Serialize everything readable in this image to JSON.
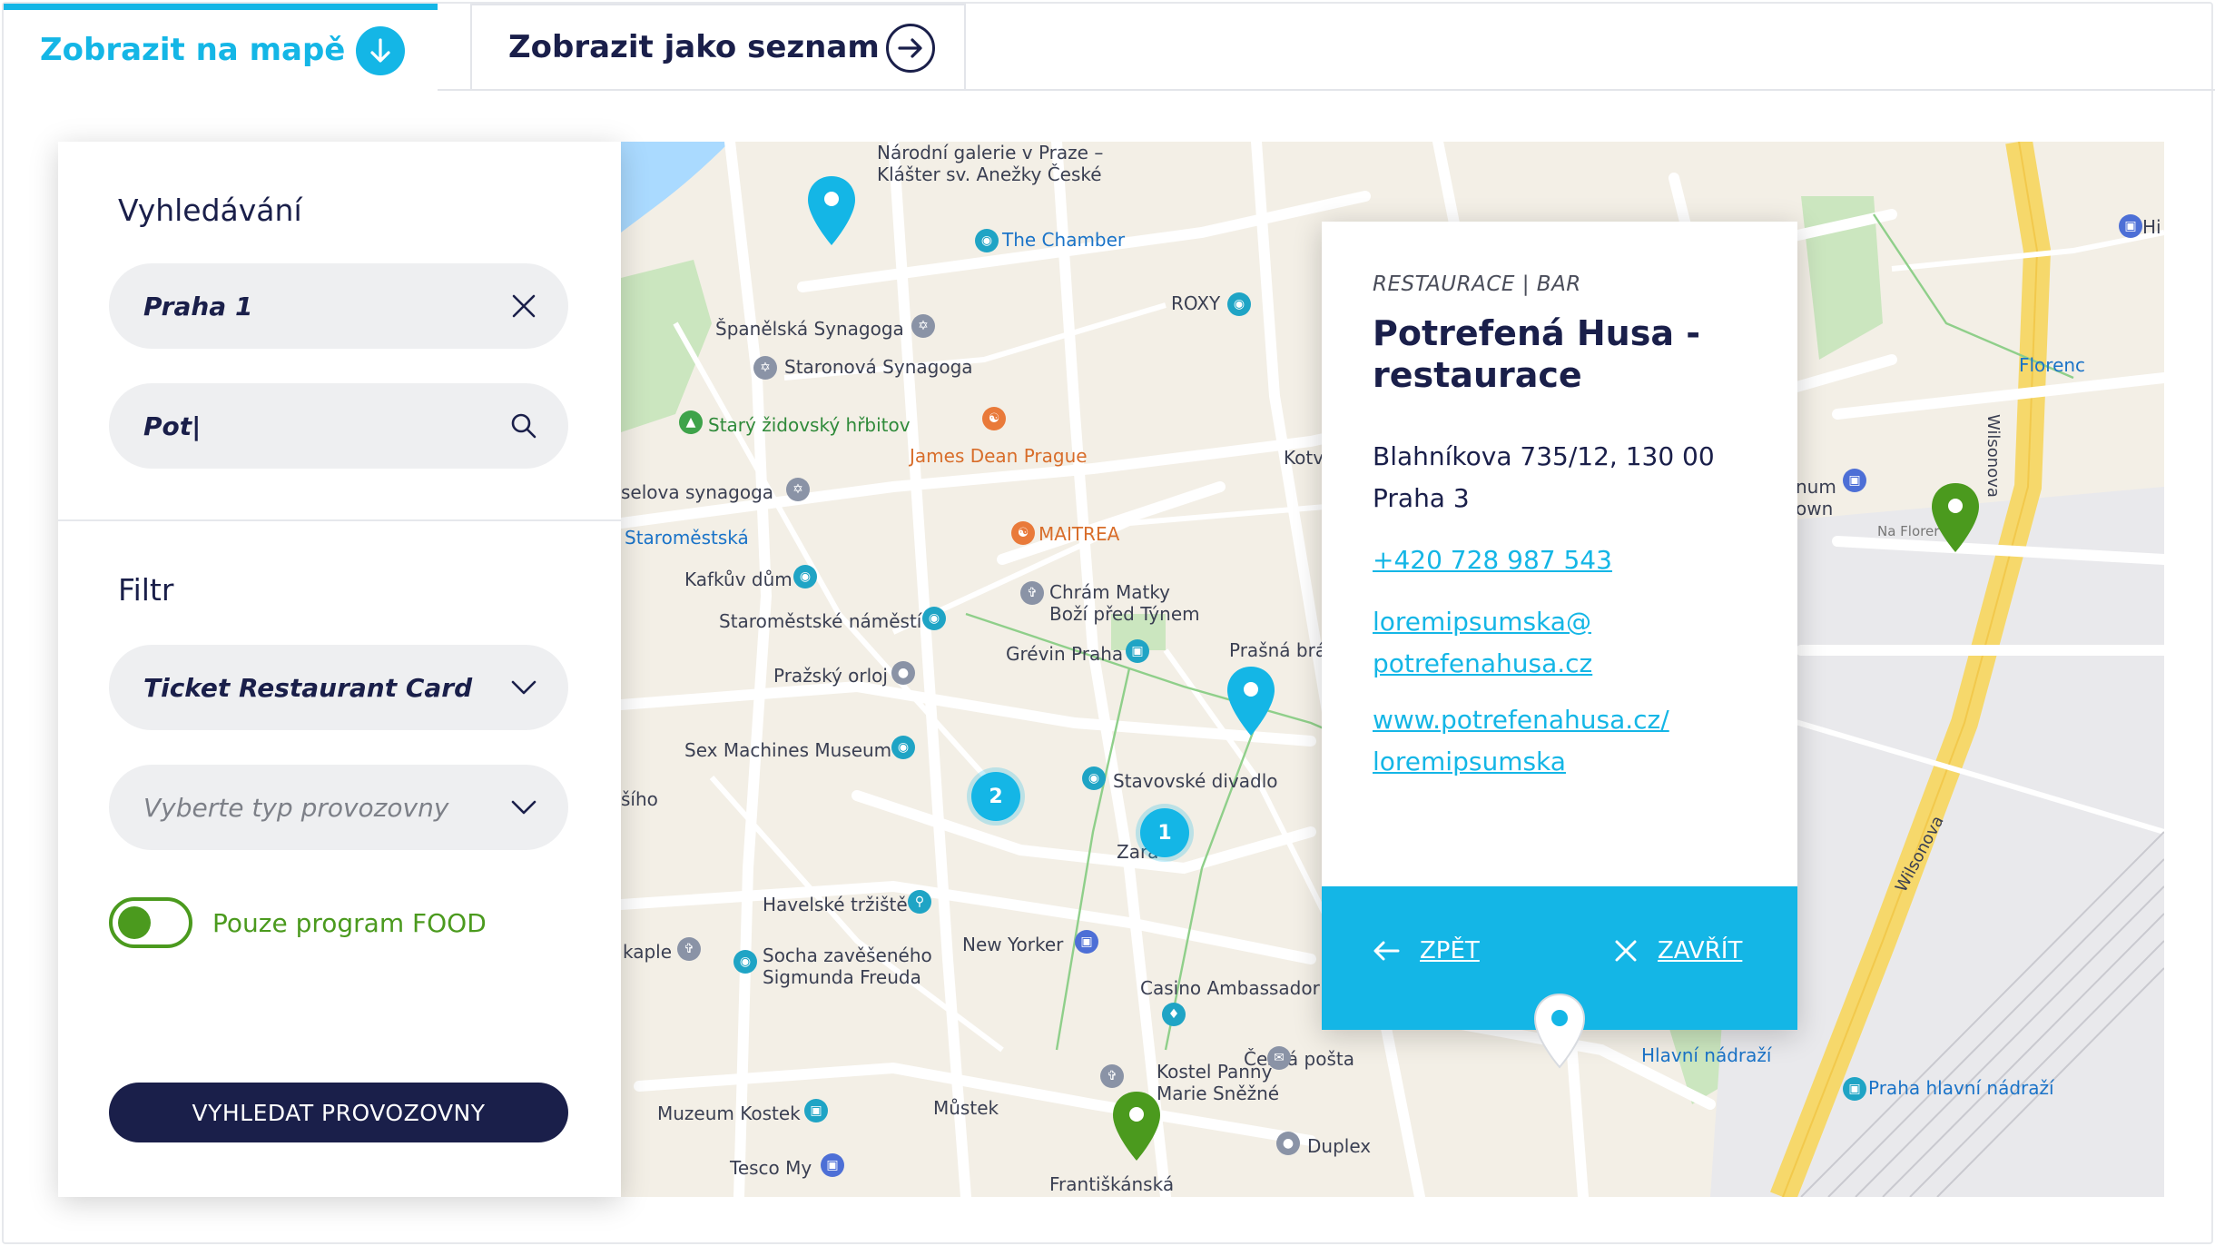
{
  "tabs": [
    {
      "label": "Zobrazit na mapě",
      "icon": "arrow-down-icon",
      "active": true
    },
    {
      "label": "Zobrazit jako seznam",
      "icon": "arrow-right-icon",
      "active": false
    }
  ],
  "sidebar": {
    "search_heading": "Vyhledávání",
    "location_value": "Praha 1",
    "query_value": "Pot|",
    "filter_heading": "Filtr",
    "card_select_value": "Ticket Restaurant Card",
    "type_select_placeholder": "Vyberte typ provozovny",
    "food_toggle_label": "Pouze program FOOD",
    "food_toggle_on": true,
    "search_button": "VYHLEDAT PROVOZOVNY"
  },
  "map_labels": [
    {
      "text": "Národní galerie v Praze –\nKlášter sv. Anežky České"
    },
    {
      "text": "The Chamber"
    },
    {
      "text": "Španělská Synagoga"
    },
    {
      "text": "Staronová Synagoga"
    },
    {
      "text": "Starý židovský hřbitov"
    },
    {
      "text": "James Dean Prague"
    },
    {
      "text": "selova synagoga"
    },
    {
      "text": "Staroměstská"
    },
    {
      "text": "MAITREA"
    },
    {
      "text": "Kafkův dům"
    },
    {
      "text": "Chrám Matky\nBoží před Týnem"
    },
    {
      "text": "Staroměstské náměstí"
    },
    {
      "text": "Grévin Praha"
    },
    {
      "text": "Pražský orloj"
    },
    {
      "text": "Prašná brá"
    },
    {
      "text": "Sex Machines Museum"
    },
    {
      "text": "Stavovské divadlo"
    },
    {
      "text": "Zara"
    },
    {
      "text": "Havelské tržiště"
    },
    {
      "text": "New Yorker"
    },
    {
      "text": "kaple"
    },
    {
      "text": "Socha zavěšeného\nSigmunda Freuda"
    },
    {
      "text": "Casino Ambassador"
    },
    {
      "text": "Kostel Panny\nMarie Sněžné"
    },
    {
      "text": "Česká pošta"
    },
    {
      "text": "Muzeum Kostek"
    },
    {
      "text": "Můstek"
    },
    {
      "text": "Duplex"
    },
    {
      "text": "Tesco My"
    },
    {
      "text": "Františkánská"
    },
    {
      "text": "ROXY"
    },
    {
      "text": "Florenc"
    },
    {
      "text": "Hlavní nádraží"
    },
    {
      "text": "Praha hlavní nádraží"
    },
    {
      "text": "Wilsonova"
    },
    {
      "text": "Wilsonova"
    },
    {
      "text": "Kotv"
    },
    {
      "text": "šího"
    },
    {
      "text": "num\nown"
    },
    {
      "text": "Na Florer"
    },
    {
      "text": "Hi"
    }
  ],
  "clusters": [
    {
      "count": "2"
    },
    {
      "count": "1"
    }
  ],
  "popup": {
    "category": "RESTAURACE | BAR",
    "title": "Potrefená Husa - restaurace",
    "address": "Blahníkova 735/12, 130 00 Praha 3",
    "phone": "+420 728 987 543",
    "email": "loremipsumska@\npotrefenahusa.cz",
    "web": "www.potrefenahusa.cz/\nloremipsumska",
    "back_label": "ZPĚT",
    "close_label": "ZAVŘÍT"
  },
  "colors": {
    "accent": "#14b6e6",
    "navy": "#1a1f4a",
    "food_green": "#4b9a1e"
  }
}
